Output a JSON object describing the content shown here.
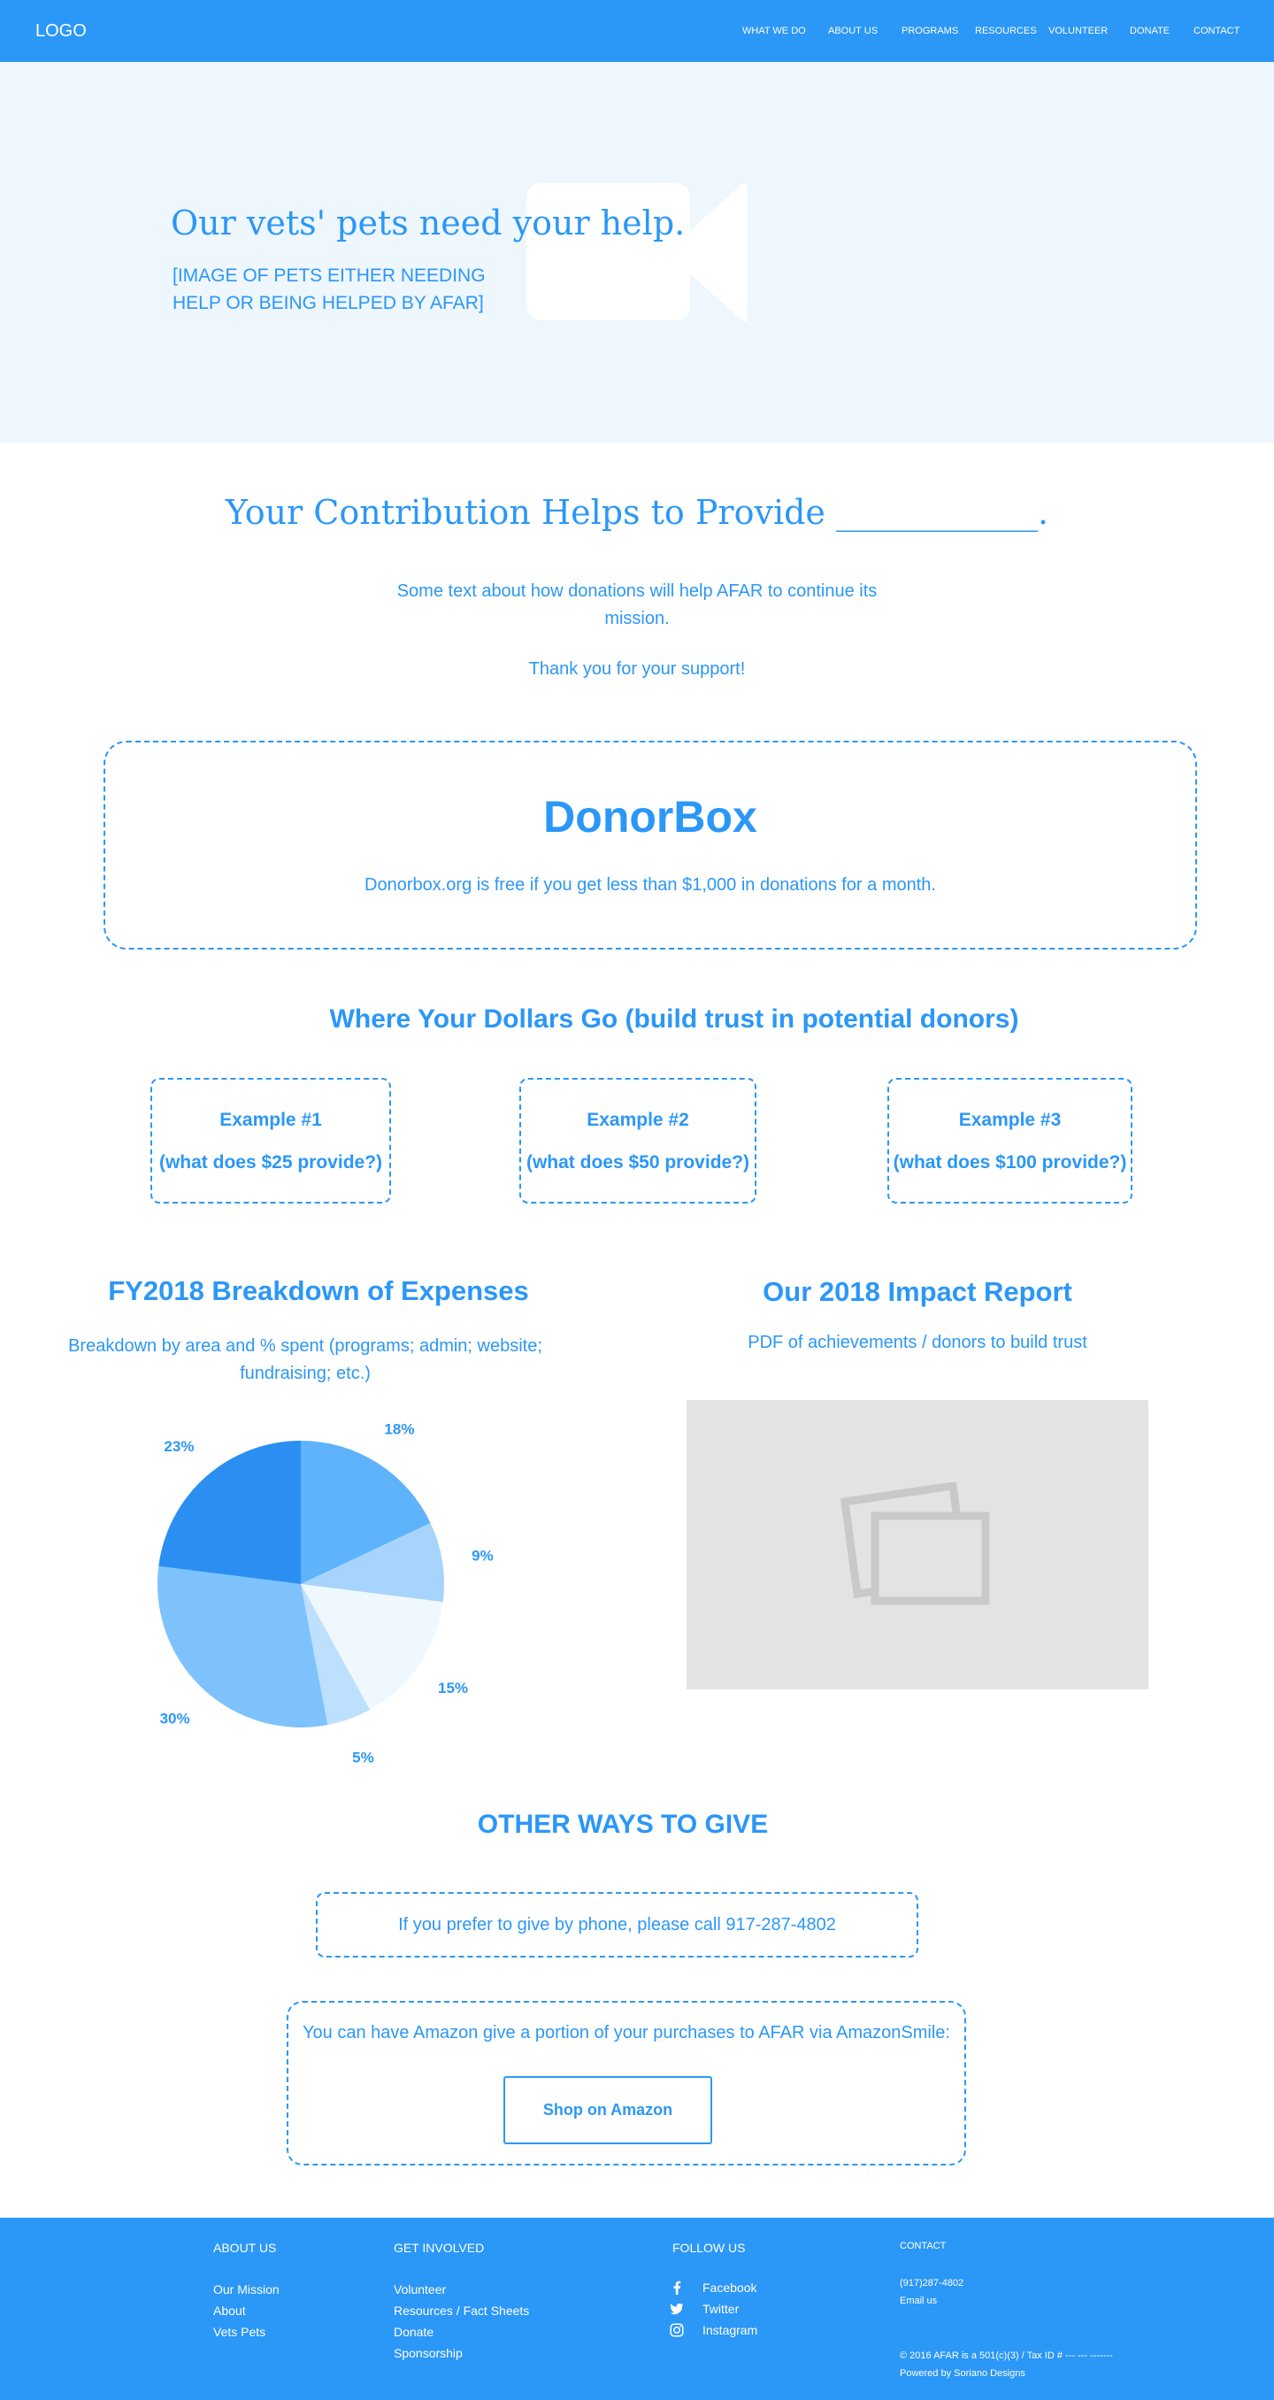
{
  "header": {
    "logo": "LOGO",
    "nav": [
      "WHAT WE DO",
      "ABOUT US",
      "PROGRAMS",
      "RESOURCES",
      "VOLUNTEER",
      "DONATE",
      "CONTACT"
    ]
  },
  "hero": {
    "title": "Our vets' pets need your help.",
    "subtitle": "[IMAGE OF PETS EITHER NEEDING HELP OR BEING HELPED BY AFAR]",
    "video_icon": "video-camera-icon"
  },
  "contribution": {
    "title": "Your Contribution Helps to Provide ____________.",
    "text": "Some text about how donations will help AFAR to continue its mission.",
    "thanks": "Thank you for your support!"
  },
  "donorbox": {
    "title": "DonorBox",
    "note": "Donorbox.org is free if you get less than $1,000 in donations for a month."
  },
  "dollars": {
    "title": "Where Your Dollars Go (build trust in potential donors)",
    "examples": [
      {
        "title": "Example #1",
        "sub": "(what does $25 provide?)"
      },
      {
        "title": "Example #2",
        "sub": "(what does $50 provide?)"
      },
      {
        "title": "Example #3",
        "sub": "(what does $100 provide?)"
      }
    ]
  },
  "expenses": {
    "title": "FY2018 Breakdown of Expenses",
    "subtitle": "Breakdown by area and % spent (programs; admin; website; fundraising; etc.)"
  },
  "chart_data": {
    "type": "pie",
    "values": [
      18,
      9,
      15,
      5,
      30,
      23
    ],
    "labels": [
      "18%",
      "9%",
      "15%",
      "5%",
      "30%",
      "23%"
    ],
    "colors": [
      "#5eb3fb",
      "#a7d4fc",
      "#eff7ff",
      "#bde0fe",
      "#7ec2fd",
      "#2b8ff2"
    ]
  },
  "impact": {
    "title": "Our 2018 Impact Report",
    "subtitle": "PDF of achievements / donors to build trust",
    "image_icon": "image-placeholder-icon"
  },
  "other_ways": {
    "title": "OTHER WAYS TO GIVE",
    "phone_text": "If you prefer to give by phone, please call 917-287-4802",
    "amazon_text": "You can have Amazon give a portion of your purchases to AFAR via AmazonSmile:",
    "amazon_button": "Shop on Amazon"
  },
  "footer": {
    "about_heading": "ABOUT US",
    "about_links": [
      "Our Mission",
      "About",
      "Vets Pets"
    ],
    "involved_heading": "GET INVOLVED",
    "involved_links": [
      "Volunteer",
      "Resources / Fact Sheets",
      "Donate",
      "Sponsorship"
    ],
    "follow_heading": "FOLLOW US",
    "social": [
      {
        "label": "Facebook",
        "icon": "facebook-icon"
      },
      {
        "label": "Twitter",
        "icon": "twitter-icon"
      },
      {
        "label": "Instagram",
        "icon": "instagram-icon"
      }
    ],
    "contact_heading": "CONTACT",
    "phone": "(917)287-4802",
    "email": "Email us",
    "legal": "© 2016 AFAR is a 501(c)(3) / Tax ID # --- --- -------",
    "powered": "Powered by Soriano Designs"
  }
}
